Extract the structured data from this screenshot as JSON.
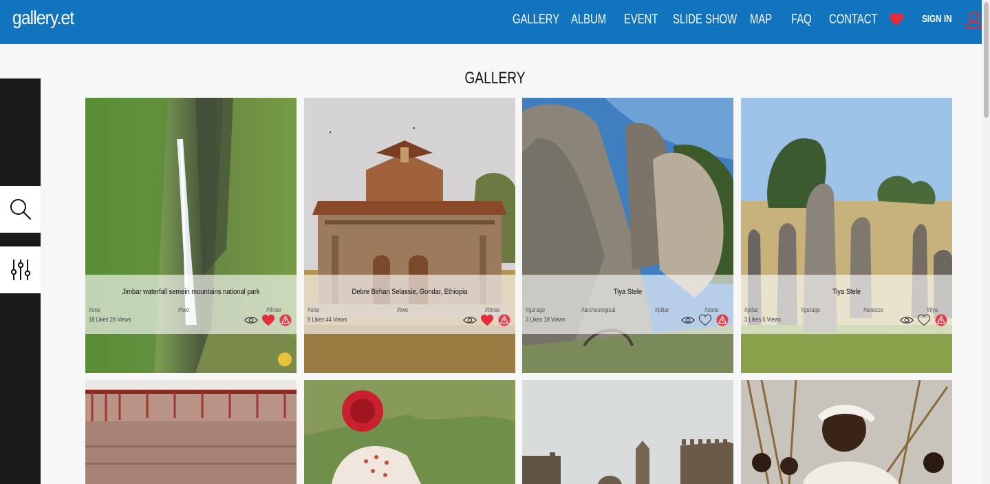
{
  "brand": {
    "logo": "gallery.et"
  },
  "nav": {
    "items": [
      {
        "label": "GALLERY"
      },
      {
        "label": "ALBUM"
      },
      {
        "label": "EVENT"
      },
      {
        "label": "SLIDE SHOW"
      },
      {
        "label": "MAP"
      },
      {
        "label": "FAQ"
      },
      {
        "label": "CONTACT"
      }
    ],
    "signin": "SIGN IN"
  },
  "page": {
    "title": "GALLERY"
  },
  "colors": {
    "header": "#1273be",
    "like": "#e12d3c",
    "report": "#e0414d"
  },
  "gallery": {
    "cards": [
      {
        "title": "Jimbar waterfall semein mountains national park",
        "tags": [
          "#one",
          "#two",
          "#three"
        ],
        "stats": "18 Likes 28 Views",
        "liked": true
      },
      {
        "title": "Debre Birhan Selassie, Gondar, Ethiopia",
        "tags": [
          "#one",
          "#two",
          "#three"
        ],
        "stats": "8 Likes 44 Views",
        "liked": true
      },
      {
        "title": "Tiya Stele",
        "tags": [
          "#gurage",
          "#archeological",
          "#pillar",
          "#stele"
        ],
        "stats": "3 Likes 18 Views",
        "liked": false
      },
      {
        "title": "Tiya Stele",
        "tags": [
          "#pillar",
          "#gurage",
          "#unesco",
          "#tiya"
        ],
        "stats": "3 Likes 5 Views",
        "liked": false
      }
    ]
  }
}
